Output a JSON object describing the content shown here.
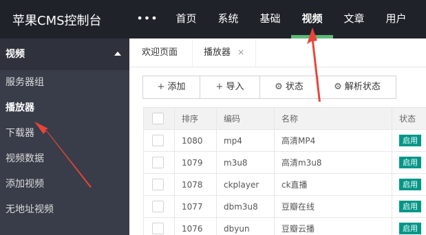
{
  "header": {
    "brand": "苹果CMS控制台",
    "more_label": "•••",
    "nav": [
      "首页",
      "系统",
      "基础",
      "视频",
      "文章",
      "用户"
    ],
    "active_nav": "视频"
  },
  "sidebar": {
    "section_title": "视频",
    "items": [
      "服务器组",
      "播放器",
      "下载器",
      "视频数据",
      "添加视频",
      "无地址视频"
    ],
    "active_item": "播放器"
  },
  "tabs": {
    "welcome": "欢迎页面",
    "player": "播放器",
    "close": "×"
  },
  "toolbar": {
    "add": "添加",
    "import": "导入",
    "status": "状态",
    "parse_status": "解析状态",
    "icons": {
      "add": "plus-icon",
      "import": "plus-icon",
      "status": "gear-icon",
      "parse_status": "gear-icon"
    }
  },
  "table": {
    "headers": [
      "排序",
      "编码",
      "名称",
      "状态"
    ],
    "rows": [
      {
        "sort": "1080",
        "code": "mp4",
        "name": "高清MP4",
        "status": "启用"
      },
      {
        "sort": "1079",
        "code": "m3u8",
        "name": "高清m3u8",
        "status": "启用"
      },
      {
        "sort": "1078",
        "code": "ckplayer",
        "name": "ck直播",
        "status": "启用"
      },
      {
        "sort": "1077",
        "code": "dbm3u8",
        "name": "豆瓣在线",
        "status": "启用"
      },
      {
        "sort": "1076",
        "code": "dbyun",
        "name": "豆瓣云播",
        "status": "启用"
      }
    ]
  },
  "colors": {
    "header_bg": "#20222a",
    "sidebar_bg": "#393d49",
    "active_underline": "#5fb878",
    "badge": "#009688",
    "arrow": "#e8443a"
  }
}
